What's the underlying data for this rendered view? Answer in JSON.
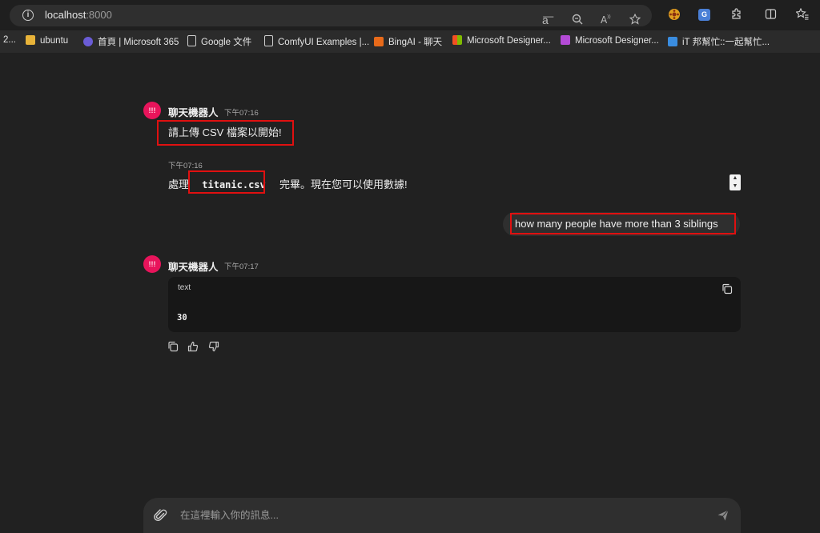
{
  "browser": {
    "url_host": "localhost",
    "url_port": ":8000",
    "bookmarks": [
      {
        "label": "2...",
        "color": ""
      },
      {
        "label": "ubuntu",
        "color": "#e8b339"
      },
      {
        "label": "首頁 | Microsoft 365",
        "color": "#6a5cd6"
      },
      {
        "label": "Google 文件",
        "color": "#cfcfcf"
      },
      {
        "label": "ComfyUI Examples |...",
        "color": "#cfcfcf"
      },
      {
        "label": "BingAI - 聊天",
        "color": "#e86a1a"
      },
      {
        "label": "Microsoft Designer...",
        "color": "#f25022"
      },
      {
        "label": "Microsoft Designer...",
        "color": "#b44bd6"
      },
      {
        "label": "iT 邦幫忙::一起幫忙...",
        "color": "#3a8de0"
      }
    ]
  },
  "chat": {
    "bot_name": "聊天機器人",
    "avatar_text": "!!!",
    "messages": [
      {
        "role": "bot",
        "time": "下午07:16",
        "text": "請上傳 CSV 檔案以開始!"
      },
      {
        "role": "bot",
        "time": "下午07:16",
        "text_before": "處理",
        "code": "titanic.csv",
        "text_after": "完畢。現在您可以使用數據!"
      },
      {
        "role": "user",
        "text": "how many people have more than 3 siblings"
      },
      {
        "role": "bot",
        "time": "下午07:17",
        "code_lang": "text",
        "code_output": "30"
      }
    ],
    "composer_placeholder": "在這裡輸入你的訊息..."
  },
  "colors": {
    "background": "#212121",
    "avatar": "#e8145b",
    "highlight_box": "#e01010"
  }
}
